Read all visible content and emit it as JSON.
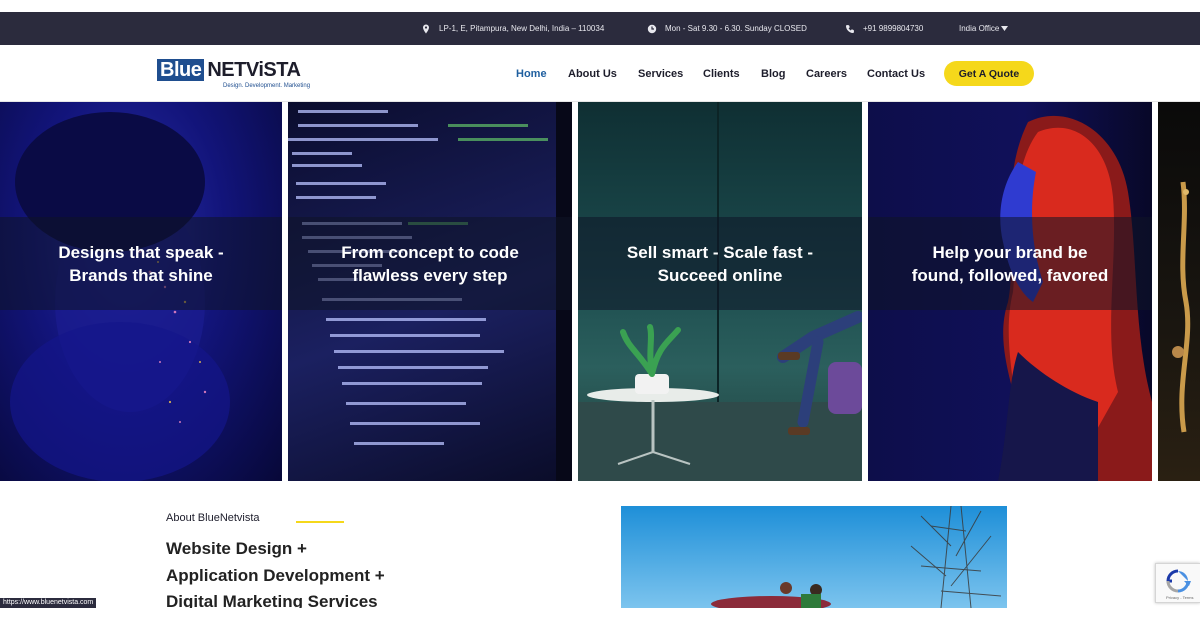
{
  "topbar": {
    "address": "LP-1, E, Pitampura, New Delhi, India – 110034",
    "hours": "Mon - Sat 9.30 - 6.30. Sunday CLOSED",
    "phone": "+91 9899804730",
    "office": "India Office"
  },
  "logo": {
    "blue": "Blue",
    "rest": "NETViSTA",
    "tagline": "Design. Development. Marketing"
  },
  "nav": {
    "items": [
      "Home",
      "About Us",
      "Services",
      "Clients",
      "Blog",
      "Careers",
      "Contact Us"
    ],
    "cta": "Get A Quote"
  },
  "hero": {
    "slides": [
      "Designs that speak -\nBrands that shine",
      "From concept to code\nflawless every step",
      "Sell smart - Scale fast -\nSucceed online",
      "Help your brand be\nfound, followed, favored"
    ]
  },
  "about": {
    "label": "About BlueNetvista",
    "lines": [
      "Website Design +",
      "Application Development +",
      "Digital Marketing Services"
    ]
  },
  "statusbar": {
    "url": "https://www.bluenetvista.com"
  },
  "recaptcha": {
    "text": "Privacy - Terms"
  },
  "colors": {
    "accent": "#f5d81b",
    "brand": "#1f4e8f",
    "topbar": "#2b2b3d"
  }
}
